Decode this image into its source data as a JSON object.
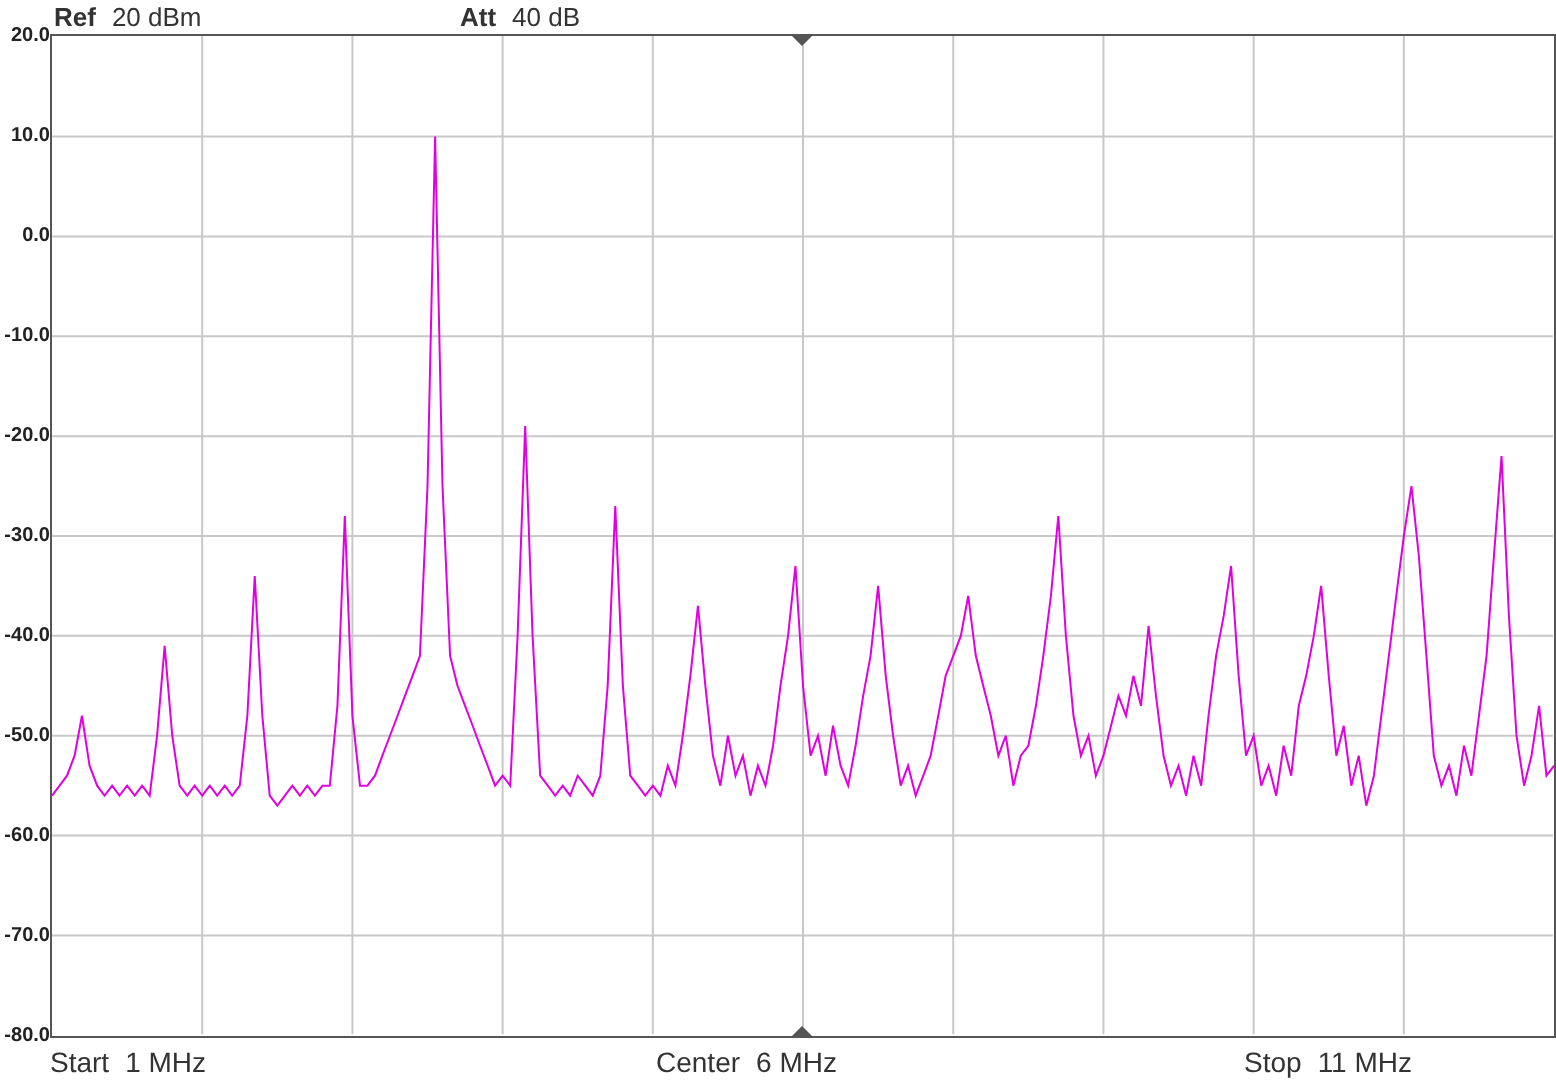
{
  "header": [
    {
      "label": "Ref",
      "value": "20 dBm"
    },
    {
      "label": "Att",
      "value": "40 dB"
    }
  ],
  "chart_data": {
    "type": "line",
    "grid": true,
    "ylim": [
      -80,
      20
    ],
    "yticks": [
      {
        "value": 20,
        "label": "20.0"
      },
      {
        "value": 10,
        "label": "10.0"
      },
      {
        "value": 0,
        "label": "0.0"
      },
      {
        "value": -10,
        "label": "-10.0"
      },
      {
        "value": -20,
        "label": "-20.0"
      },
      {
        "value": -30,
        "label": "-30.0"
      },
      {
        "value": -40,
        "label": "-40.0"
      },
      {
        "value": -50,
        "label": "-50.0"
      },
      {
        "value": -60,
        "label": "-60.0"
      },
      {
        "value": -70,
        "label": "-70.0"
      },
      {
        "value": -80,
        "label": "-80.0"
      }
    ],
    "categories": [
      null,
      null,
      null,
      null,
      null,
      null,
      null,
      null,
      null,
      null,
      null,
      null,
      null,
      null,
      null,
      null,
      null,
      null,
      null,
      null,
      null,
      null,
      null,
      null,
      null,
      null,
      null,
      null,
      null,
      null,
      null,
      null,
      null,
      null,
      null,
      null,
      null,
      null,
      null,
      null,
      null,
      null,
      null,
      null,
      null,
      null,
      null,
      null,
      null,
      null,
      null,
      null,
      null,
      null,
      null,
      null,
      null,
      null,
      null,
      null,
      null,
      null,
      null,
      null,
      null,
      null,
      null,
      null,
      null,
      null,
      null,
      null,
      null,
      null,
      null,
      null,
      null,
      null,
      null,
      null,
      null,
      null,
      null,
      null,
      null,
      null,
      null,
      null,
      null,
      null,
      null,
      null,
      null,
      null,
      null,
      null,
      null,
      null,
      null,
      null,
      null,
      null,
      null,
      null,
      null,
      null,
      null,
      null,
      null,
      null,
      null,
      null,
      null,
      null,
      null,
      null,
      null,
      null,
      null,
      null,
      null,
      null,
      null,
      null,
      null,
      null,
      null,
      null,
      null,
      null,
      null,
      null,
      null,
      null,
      null,
      null,
      null,
      null,
      null,
      null,
      null,
      null,
      null,
      null,
      null,
      null,
      null,
      null,
      null,
      null,
      null,
      null,
      null,
      null,
      null,
      null,
      null,
      null,
      null,
      null,
      null,
      null,
      null,
      null,
      null,
      null,
      null,
      null,
      null,
      null,
      null,
      null,
      null,
      null,
      null,
      null,
      null,
      null,
      null,
      null,
      null,
      null,
      null,
      null,
      null,
      null,
      null,
      null,
      null,
      null,
      null,
      null,
      null,
      null,
      null,
      null,
      null,
      null,
      null,
      null,
      null
    ],
    "series": [
      {
        "color": "#e000e0",
        "values": [
          -56,
          -55,
          -54,
          -52,
          -48,
          -53,
          -55,
          -56,
          -55,
          -56,
          -55,
          -56,
          -55,
          -56,
          -50,
          -41,
          -50,
          -55,
          -56,
          -55,
          -56,
          -55,
          -56,
          -55,
          -56,
          -55,
          -48,
          -34,
          -48,
          -56,
          -57,
          -56,
          -55,
          -56,
          -55,
          -56,
          -55,
          -55,
          -47,
          -28,
          -48,
          -55,
          -55,
          -54,
          -52,
          -50,
          -48,
          -46,
          -44,
          -42,
          -25,
          10,
          -25,
          -42,
          -45,
          -47,
          -49,
          -51,
          -53,
          -55,
          -54,
          -55,
          -40,
          -19,
          -40,
          -54,
          -55,
          -56,
          -55,
          -56,
          -54,
          -55,
          -56,
          -54,
          -45,
          -27,
          -45,
          -54,
          -55,
          -56,
          -55,
          -56,
          -53,
          -55,
          -50,
          -44,
          -37,
          -45,
          -52,
          -55,
          -50,
          -54,
          -52,
          -56,
          -53,
          -55,
          -51,
          -45,
          -40,
          -33,
          -45,
          -52,
          -50,
          -54,
          -49,
          -53,
          -55,
          -51,
          -46,
          -42,
          -35,
          -44,
          -50,
          -55,
          -53,
          -56,
          -54,
          -52,
          -48,
          -44,
          -42,
          -40,
          -36,
          -42,
          -45,
          -48,
          -52,
          -50,
          -55,
          -52,
          -51,
          -47,
          -42,
          -36,
          -28,
          -40,
          -48,
          -52,
          -50,
          -54,
          -52,
          -49,
          -46,
          -48,
          -44,
          -47,
          -39,
          -46,
          -52,
          -55,
          -53,
          -56,
          -52,
          -55,
          -48,
          -42,
          -38,
          -33,
          -44,
          -52,
          -50,
          -55,
          -53,
          -56,
          -51,
          -54,
          -47,
          -44,
          -40,
          -35,
          -44,
          -52,
          -49,
          -55,
          -52,
          -57,
          -54,
          -48,
          -42,
          -36,
          -30,
          -25,
          -32,
          -42,
          -52,
          -55,
          -53,
          -56,
          -51,
          -54,
          -48,
          -42,
          -32,
          -22,
          -38,
          -50,
          -55,
          -52,
          -47,
          -54,
          -53
        ]
      }
    ]
  },
  "footer": [
    {
      "label": "Start",
      "value": "1 MHz"
    },
    {
      "label": "Center",
      "value": "6 MHz"
    },
    {
      "label": "Stop",
      "value": "11 MHz"
    }
  ]
}
